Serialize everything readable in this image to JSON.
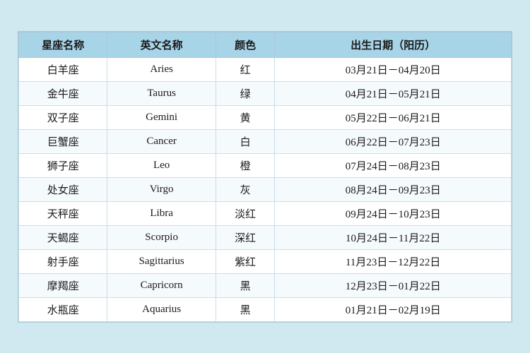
{
  "table": {
    "headers": [
      "星座名称",
      "英文名称",
      "颜色",
      "出生日期（阳历）"
    ],
    "rows": [
      {
        "name": "白羊座",
        "en": "Aries",
        "color": "红",
        "date": "03月21日－04月20日"
      },
      {
        "name": "金牛座",
        "en": "Taurus",
        "color": "绿",
        "date": "04月21日－05月21日"
      },
      {
        "name": "双子座",
        "en": "Gemini",
        "color": "黄",
        "date": "05月22日－06月21日"
      },
      {
        "name": "巨蟹座",
        "en": "Cancer",
        "color": "白",
        "date": "06月22日－07月23日"
      },
      {
        "name": "狮子座",
        "en": "Leo",
        "color": "橙",
        "date": "07月24日－08月23日"
      },
      {
        "name": "处女座",
        "en": "Virgo",
        "color": "灰",
        "date": "08月24日－09月23日"
      },
      {
        "name": "天秤座",
        "en": "Libra",
        "color": "淡红",
        "date": "09月24日－10月23日"
      },
      {
        "name": "天蝎座",
        "en": "Scorpio",
        "color": "深红",
        "date": "10月24日－11月22日"
      },
      {
        "name": "射手座",
        "en": "Sagittarius",
        "color": "紫红",
        "date": "11月23日－12月22日"
      },
      {
        "name": "摩羯座",
        "en": "Capricorn",
        "color": "黑",
        "date": "12月23日－01月22日"
      },
      {
        "name": "水瓶座",
        "en": "Aquarius",
        "color": "黑",
        "date": "01月21日－02月19日"
      }
    ]
  }
}
